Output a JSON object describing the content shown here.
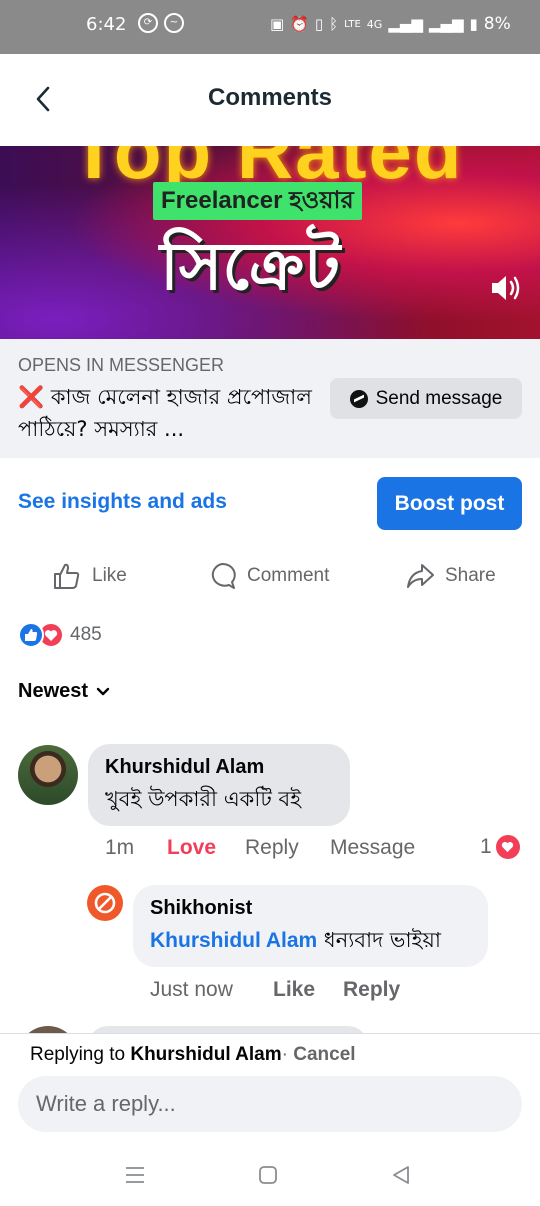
{
  "status_bar": {
    "time": "6:42",
    "battery": "8%",
    "network": "4G",
    "lte": "LTE"
  },
  "header": {
    "title": "Comments",
    "back_icon": "chevron-left-icon"
  },
  "banner": {
    "headline": "Top Rated",
    "tag": "Freelancer হওয়ার",
    "main": "সিক্রেট",
    "volume_icon": "speaker-icon"
  },
  "cta": {
    "opens_label": "OPENS IN MESSENGER",
    "promo_prefix": "❌",
    "promo_text": "কাজ মেলেনা হাজার প্রপোজাল পাঠিয়ে? সমস্যার ...",
    "send_button": "Send message"
  },
  "post_tools": {
    "insights_link": "See insights and ads",
    "boost_button": "Boost post"
  },
  "actions": {
    "like": "Like",
    "comment": "Comment",
    "share": "Share"
  },
  "reactions": {
    "count": "485"
  },
  "sort": {
    "label": "Newest"
  },
  "comments": [
    {
      "author": "Khurshidul Alam",
      "text": "খুবই উপকারী একটি বই",
      "time": "1m",
      "love_label": "Love",
      "reply_label": "Reply",
      "message_label": "Message",
      "reaction_count": "1"
    }
  ],
  "replies": [
    {
      "author": "Shikhonist",
      "mention": "Khurshidul Alam",
      "text": "ধন্যবাদ ভাইয়া",
      "time": "Just now",
      "like_label": "Like",
      "reply_label": "Reply"
    }
  ],
  "reply_bar": {
    "replying_prefix": "Replying to",
    "replying_name": "Khurshidul Alam",
    "separator": "·",
    "cancel": "Cancel",
    "placeholder": "Write a reply..."
  },
  "colors": {
    "accent": "#1b74e4",
    "love": "#f33e58",
    "muted": "#65676b"
  }
}
